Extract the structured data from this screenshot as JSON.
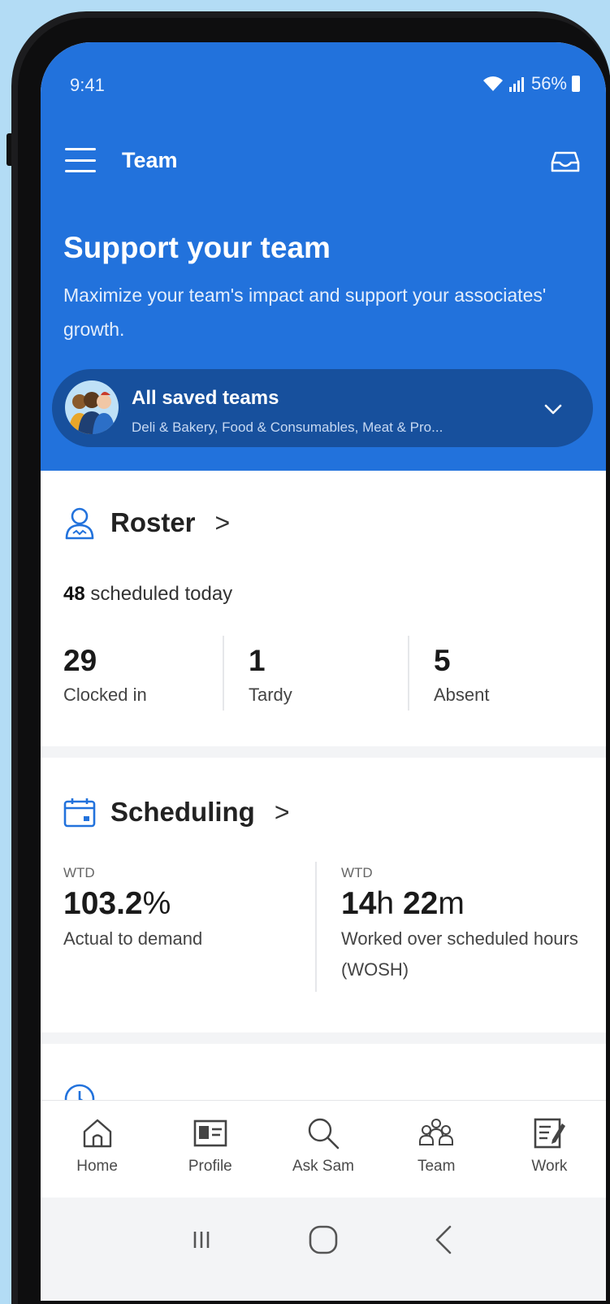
{
  "status_bar": {
    "time": "9:41",
    "battery_pct": "56%"
  },
  "app_bar": {
    "title": "Team"
  },
  "hero": {
    "title": "Support your team",
    "subtitle": "Maximize your team's impact and support your associates' growth."
  },
  "team_selector": {
    "name": "All saved teams",
    "teams": "Deli & Bakery, Food & Consumables, Meat & Pro..."
  },
  "roster": {
    "title": "Roster",
    "scheduled_count": "48",
    "scheduled_text": " scheduled today",
    "stats": [
      {
        "value": "29",
        "label": "Clocked in"
      },
      {
        "value": "1",
        "label": "Tardy"
      },
      {
        "value": "5",
        "label": "Absent"
      }
    ]
  },
  "scheduling": {
    "title": "Scheduling",
    "left": {
      "period": "WTD",
      "value": "103.2",
      "unit": "%",
      "label": "Actual to demand"
    },
    "right": {
      "period": "WTD",
      "hours": "14",
      "hours_unit": "h",
      "minutes": "22",
      "minutes_unit": "m",
      "label": "Worked over scheduled hours (WOSH)"
    }
  },
  "bottom_nav": [
    {
      "label": "Home",
      "icon": "home-icon"
    },
    {
      "label": "Profile",
      "icon": "profile-card-icon"
    },
    {
      "label": "Ask Sam",
      "icon": "search-icon"
    },
    {
      "label": "Team",
      "icon": "team-icon"
    },
    {
      "label": "Work",
      "icon": "work-icon"
    }
  ],
  "colors": {
    "brand_blue": "#2272dc",
    "selector_blue": "#17509d",
    "background": "#b3dcf5"
  }
}
